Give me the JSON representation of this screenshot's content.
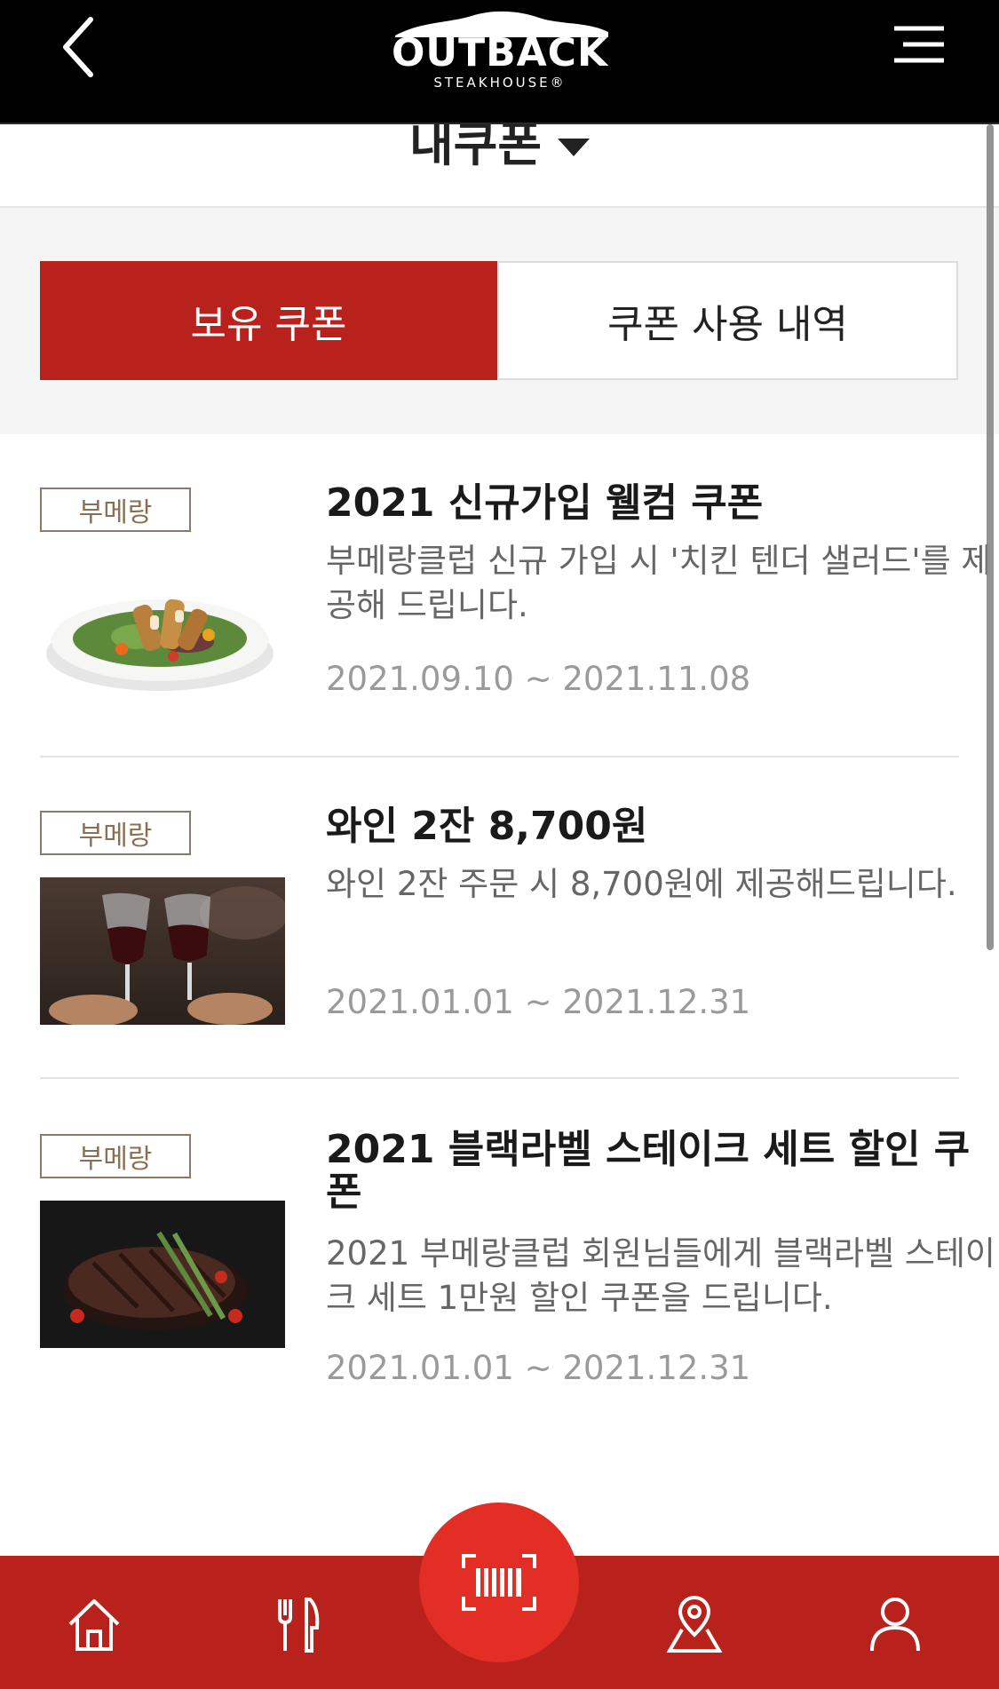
{
  "header": {
    "logo_text": "OUTBACK",
    "logo_sub": "STEAKHOUSE®"
  },
  "page": {
    "title": "내쿠폰"
  },
  "tabs": [
    {
      "label": "보유 쿠폰",
      "active": true
    },
    {
      "label": "쿠폰 사용 내역",
      "active": false
    }
  ],
  "coupons": [
    {
      "badge": "부메랑",
      "title": "2021 신규가입 웰컴 쿠폰",
      "description": "부메랑클럽 신규 가입 시 '치킨 텐더 샐러드'를 제공해 드립니다.",
      "date": "2021.09.10 ~ 2021.11.08",
      "image": "chicken-salad-icon"
    },
    {
      "badge": "부메랑",
      "title": "와인 2잔 8,700원",
      "description": "와인 2잔 주문 시 8,700원에 제공해드립니다.",
      "date": "2021.01.01 ~ 2021.12.31",
      "image": "wine-glasses-icon"
    },
    {
      "badge": "부메랑",
      "title": "2021 블랙라벨 스테이크 세트 할인 쿠폰",
      "description": "2021 부메랑클럽 회원님들에게 블랙라벨 스테이크 세트 1만원 할인 쿠폰을 드립니다.",
      "date": "2021.01.01 ~ 2021.12.31",
      "image": "steak-icon"
    }
  ],
  "bottom_nav": {
    "items": [
      "home-icon",
      "menu-fork-knife-icon",
      "barcode-scan-icon",
      "location-pin-icon",
      "user-icon"
    ]
  },
  "colors": {
    "header_bg": "#000000",
    "brand_red": "#b9221c",
    "scan_red": "#e22e24",
    "badge_border": "#8b7a66"
  }
}
